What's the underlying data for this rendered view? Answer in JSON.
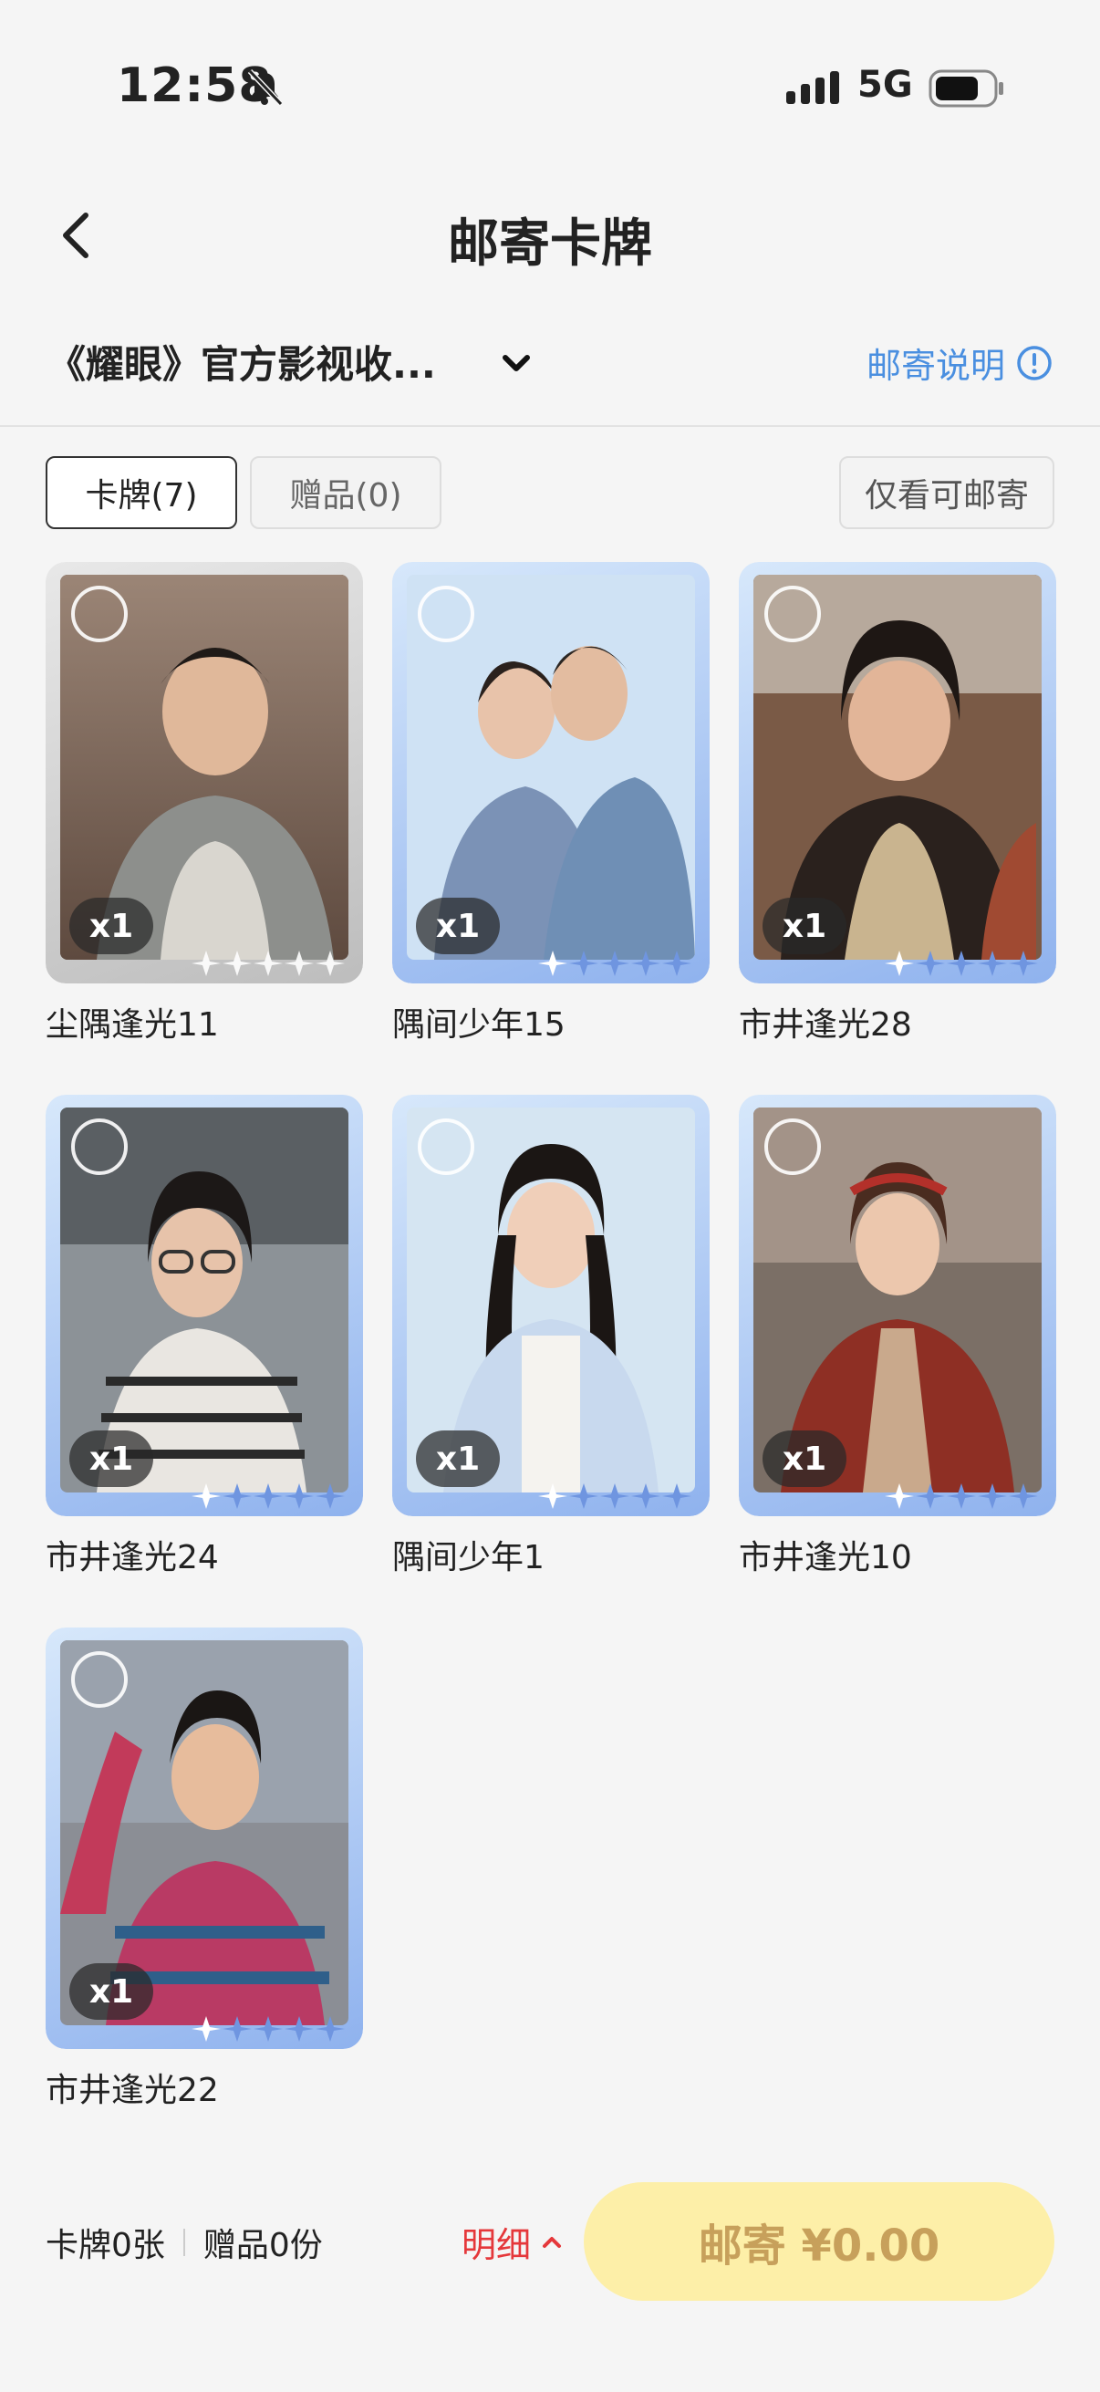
{
  "status_bar": {
    "time": "12:58",
    "network": "5G"
  },
  "header": {
    "title": "邮寄卡牌"
  },
  "album": {
    "name": "《耀眼》官方影视收...",
    "mail_info_label": "邮寄说明"
  },
  "tabs": [
    {
      "label": "卡牌(7)",
      "active": true
    },
    {
      "label": "赠品(0)",
      "active": false
    }
  ],
  "filter": {
    "label": "仅看可邮寄"
  },
  "cards": [
    {
      "name": "尘隅逢光11",
      "qty": "x1"
    },
    {
      "name": "隅间少年15",
      "qty": "x1"
    },
    {
      "name": "市井逢光28",
      "qty": "x1"
    },
    {
      "name": "市井逢光24",
      "qty": "x1"
    },
    {
      "name": "隅间少年1",
      "qty": "x1"
    },
    {
      "name": "市井逢光10",
      "qty": "x1"
    },
    {
      "name": "市井逢光22",
      "qty": "x1"
    }
  ],
  "bottom": {
    "card_count": "卡牌0张",
    "gift_count": "赠品0份",
    "detail_label": "明细",
    "mail_button": "邮寄 ¥0.00"
  },
  "colors": {
    "accent_blue": "#4a8fe0",
    "detail_red": "#e5383b",
    "button_bg": "#fdefa8"
  },
  "icons": [
    "bell-slash-icon",
    "signal-icon",
    "battery-icon",
    "back-icon",
    "chevron-down-icon",
    "info-icon",
    "chevron-up-icon"
  ]
}
